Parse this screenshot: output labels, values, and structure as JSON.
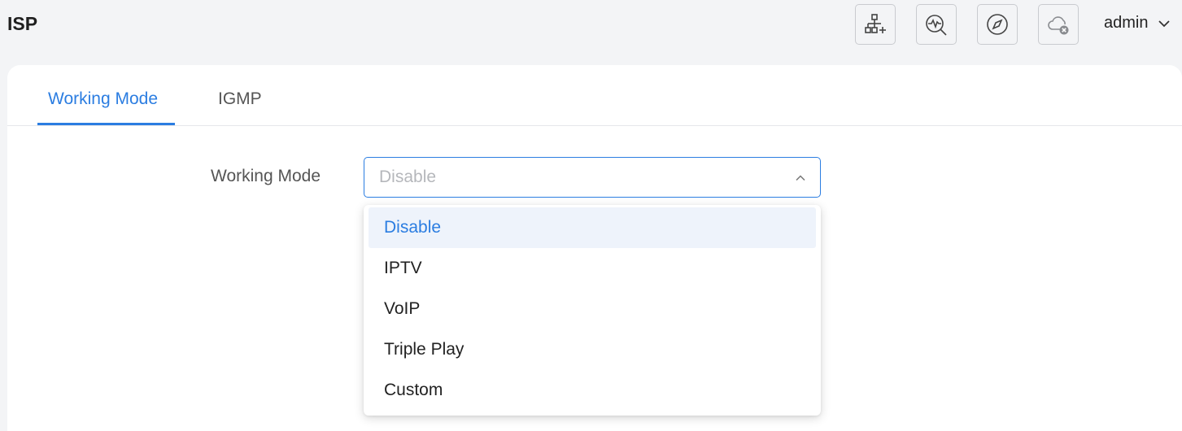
{
  "header": {
    "title": "ISP",
    "icons": [
      "topology-add-icon",
      "diagnostics-icon",
      "compass-icon",
      "cloud-disconnected-icon"
    ],
    "user": "admin"
  },
  "tabs": [
    {
      "label": "Working Mode",
      "active": true
    },
    {
      "label": "IGMP",
      "active": false
    }
  ],
  "form": {
    "working_mode_label": "Working Mode",
    "working_mode_value": "Disable",
    "options": [
      "Disable",
      "IPTV",
      "VoIP",
      "Triple Play",
      "Custom"
    ],
    "selected_index": 0
  },
  "colors": {
    "accent": "#2b7de1",
    "background": "#f3f4f6",
    "card": "#ffffff",
    "placeholder": "#b5b7bb",
    "selected_option_bg": "#eef3fb"
  }
}
